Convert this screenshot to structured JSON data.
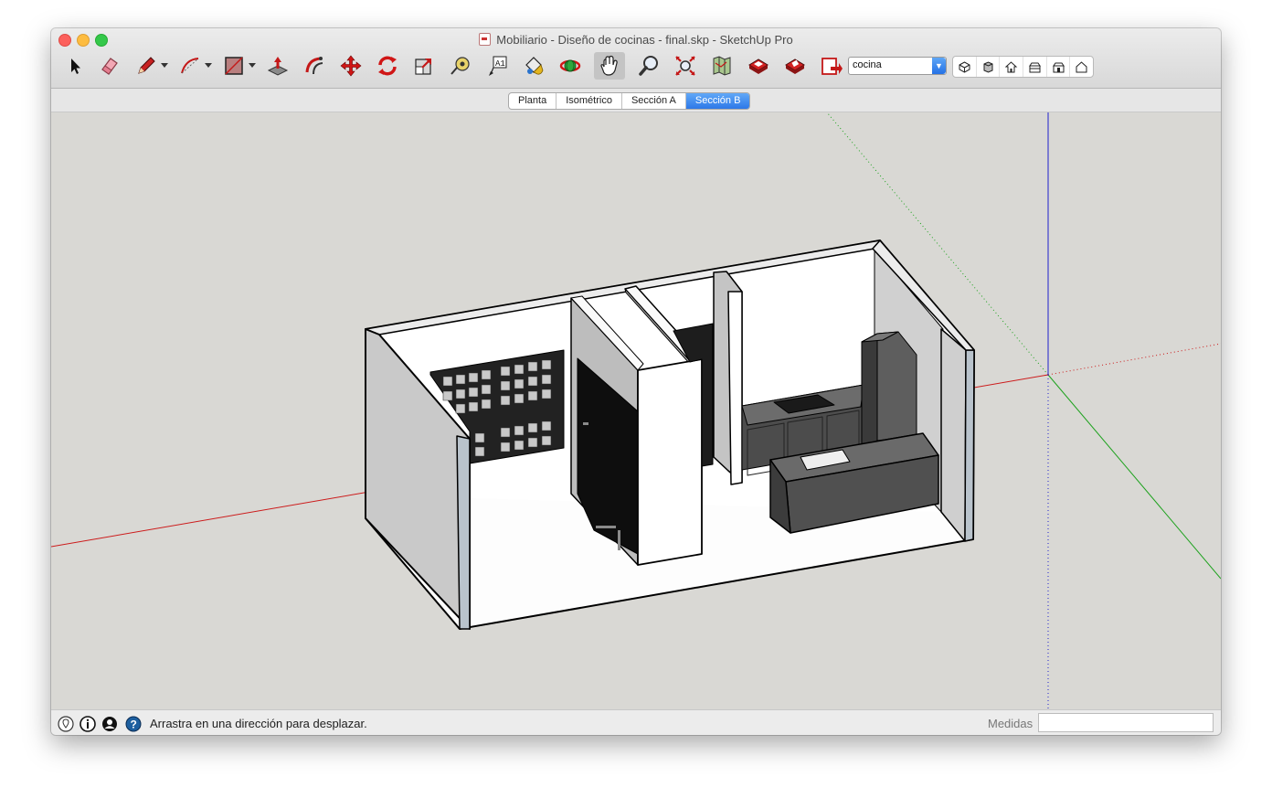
{
  "window": {
    "title": "Mobiliario - Diseño de cocinas - final.skp - SketchUp Pro"
  },
  "toolbar": {
    "tools": [
      {
        "name": "select-icon"
      },
      {
        "name": "eraser-icon"
      },
      {
        "name": "pencil-line-icon"
      },
      {
        "name": "arc-icon"
      },
      {
        "name": "rectangle-icon"
      },
      {
        "name": "push-pull-icon"
      },
      {
        "name": "offset-icon"
      },
      {
        "name": "move-icon"
      },
      {
        "name": "rotate-icon"
      },
      {
        "name": "scale-icon"
      },
      {
        "name": "tape-measure-icon"
      },
      {
        "name": "text-icon"
      },
      {
        "name": "paint-bucket-icon"
      },
      {
        "name": "orbit-icon"
      },
      {
        "name": "pan-hand-icon",
        "active": true
      },
      {
        "name": "zoom-icon"
      },
      {
        "name": "zoom-extents-icon"
      },
      {
        "name": "map-icon"
      },
      {
        "name": "warehouse-icon"
      },
      {
        "name": "extension-warehouse-icon"
      },
      {
        "name": "layout-send-icon"
      }
    ],
    "layer_select": {
      "value": "cocina"
    },
    "standard_views": [
      "iso-view-icon",
      "top-view-icon",
      "front-view-icon",
      "right-view-icon",
      "back-view-icon",
      "left-view-icon"
    ]
  },
  "scenes": {
    "tabs": [
      {
        "label": "Planta",
        "active": false
      },
      {
        "label": "Isométrico",
        "active": false
      },
      {
        "label": "Sección A",
        "active": false
      },
      {
        "label": "Sección B",
        "active": true
      }
    ]
  },
  "status": {
    "message": "Arrastra en una dirección para desplazar.",
    "measurements_label": "Medidas",
    "measurements_value": "",
    "icons": [
      "geo-location-icon",
      "credits-icon",
      "user-account-icon",
      "help-icon"
    ]
  },
  "colors": {
    "accent": "#2d78e8",
    "axis_red": "#cc1b1b",
    "axis_green": "#1ea21e",
    "axis_blue": "#2020cc",
    "model_dark": "#555555",
    "background": "#d9d8d4"
  }
}
